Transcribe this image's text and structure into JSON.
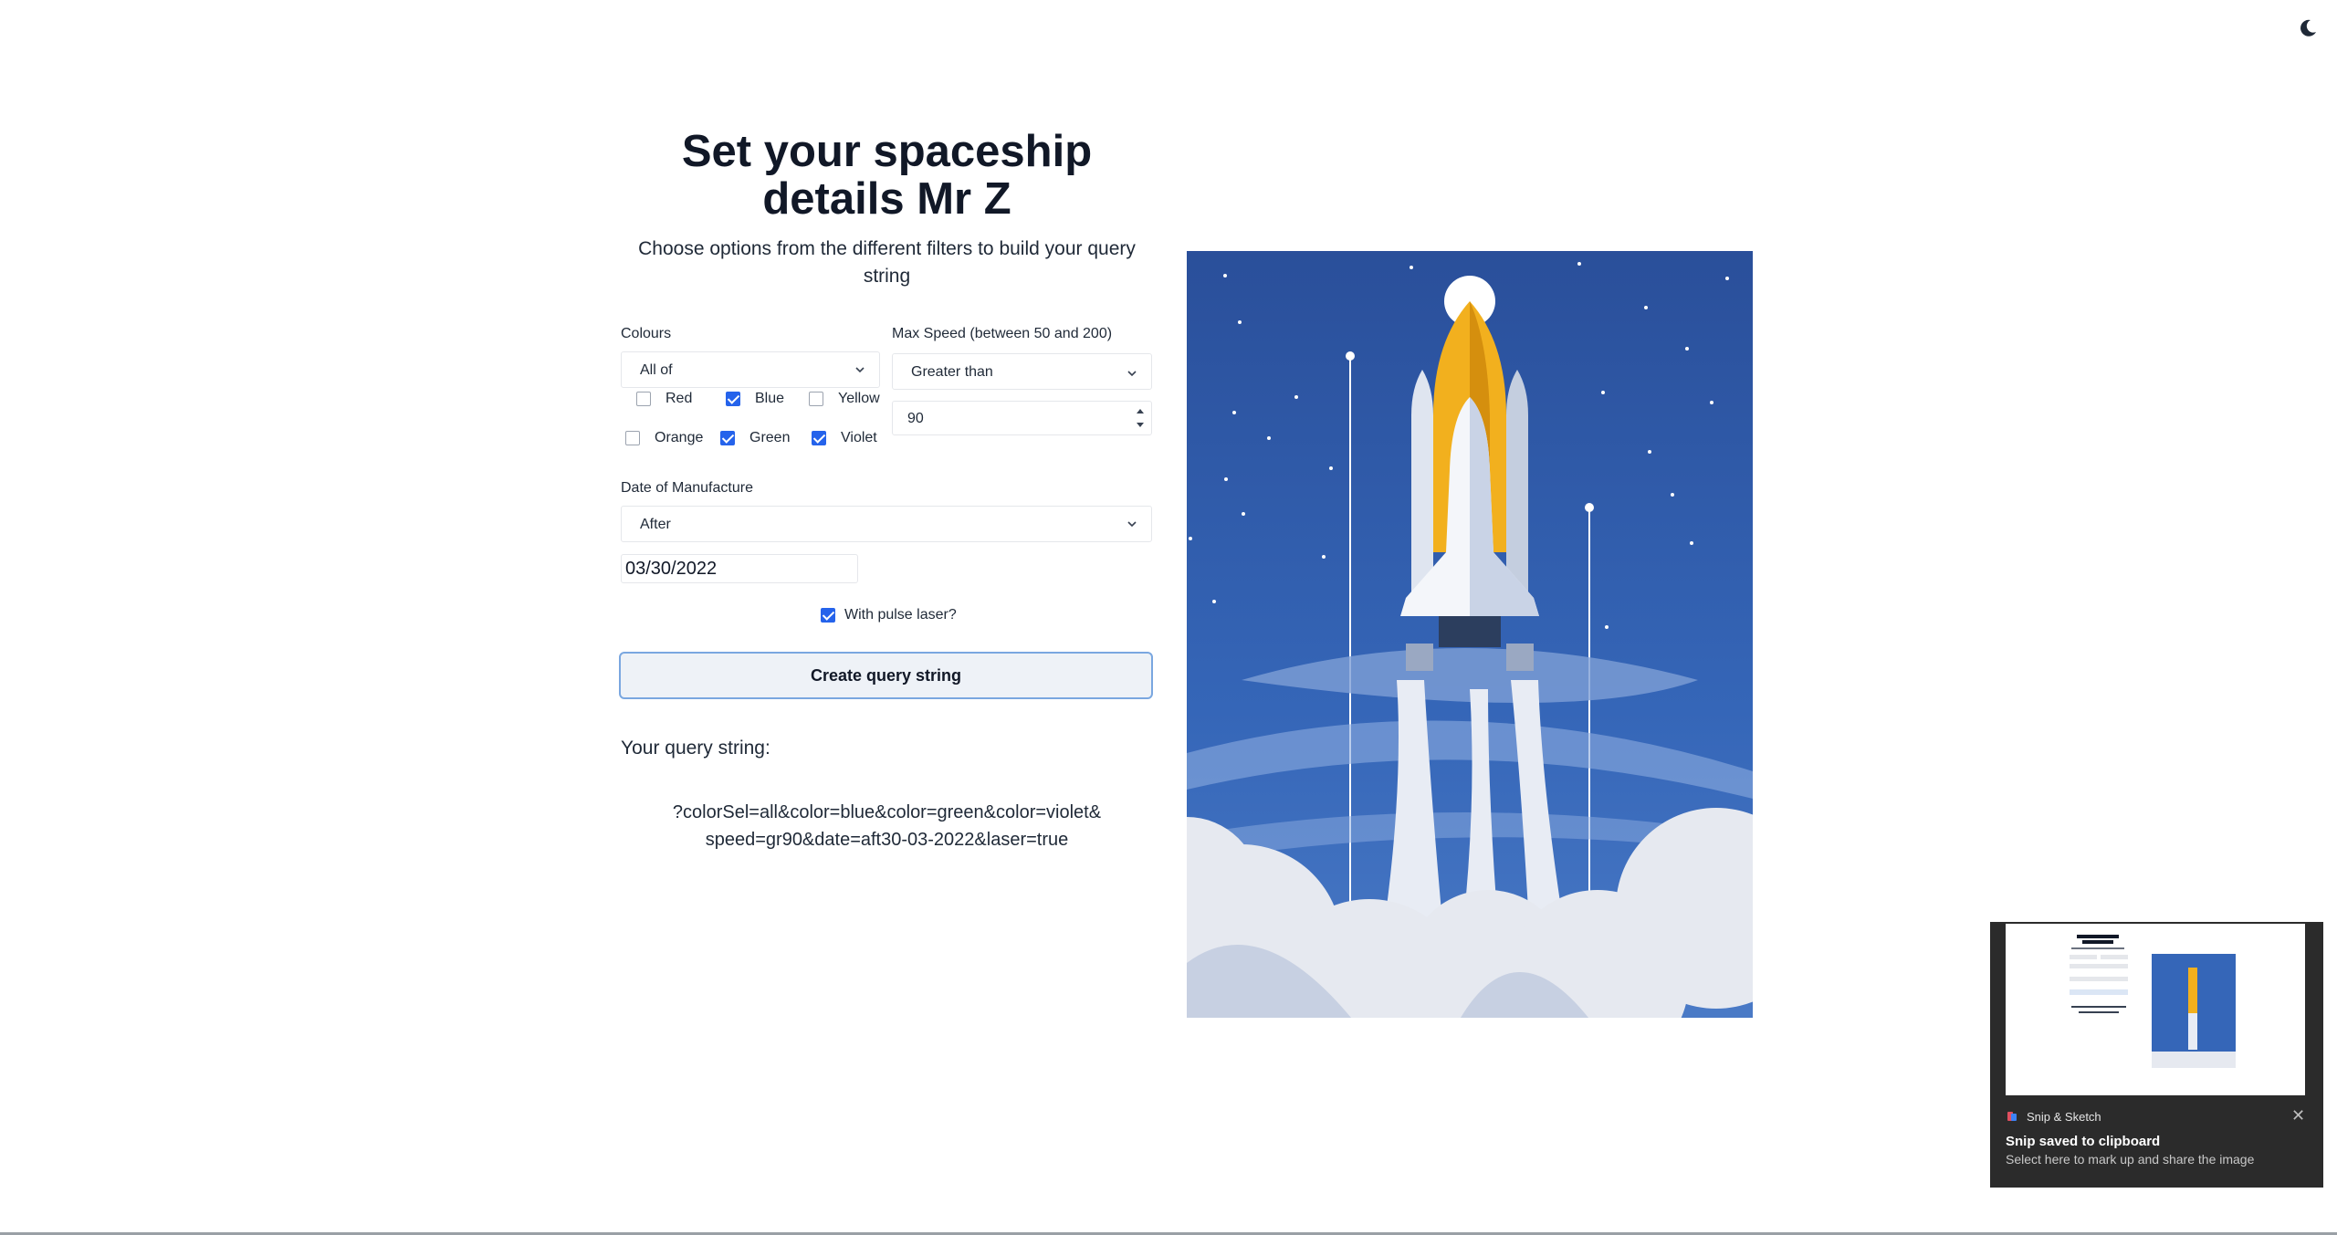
{
  "page": {
    "title": "Set your spaceship details Mr Z",
    "subtitle": "Choose options from the different filters to build your query string"
  },
  "colours": {
    "label": "Colours",
    "mode": "All of",
    "options": [
      {
        "label": "Red",
        "checked": false
      },
      {
        "label": "Blue",
        "checked": true
      },
      {
        "label": "Yellow",
        "checked": false
      },
      {
        "label": "Orange",
        "checked": false
      },
      {
        "label": "Green",
        "checked": true
      },
      {
        "label": "Violet",
        "checked": true
      }
    ]
  },
  "speed": {
    "label": "Max Speed (between 50 and 200)",
    "comparison": "Greater than",
    "value": "90"
  },
  "date": {
    "label": "Date of Manufacture",
    "comparison": "After",
    "value": "03/30/2022"
  },
  "laser": {
    "label": "With pulse laser?",
    "checked": true
  },
  "submit_label": "Create query string",
  "result": {
    "label": "Your query string:",
    "line1": "?colorSel=all&color=blue&color=green&color=violet&",
    "line2": "speed=gr90&date=aft30-03-2022&laser=true"
  },
  "toast": {
    "app": "Snip & Sketch",
    "title": "Snip saved to clipboard",
    "body": "Select here to mark up and share the image"
  },
  "icons": {
    "theme": "moon-icon",
    "dropdown": "chevron-down-icon",
    "spinner": "spinner-arrows-icon",
    "close": "close-icon",
    "app": "snip-sketch-icon"
  },
  "colors": {
    "accent": "#2563eb",
    "button_border": "#7aa7e0",
    "sky": "#2f5aa8",
    "toast_bg": "#2b2b2b"
  }
}
